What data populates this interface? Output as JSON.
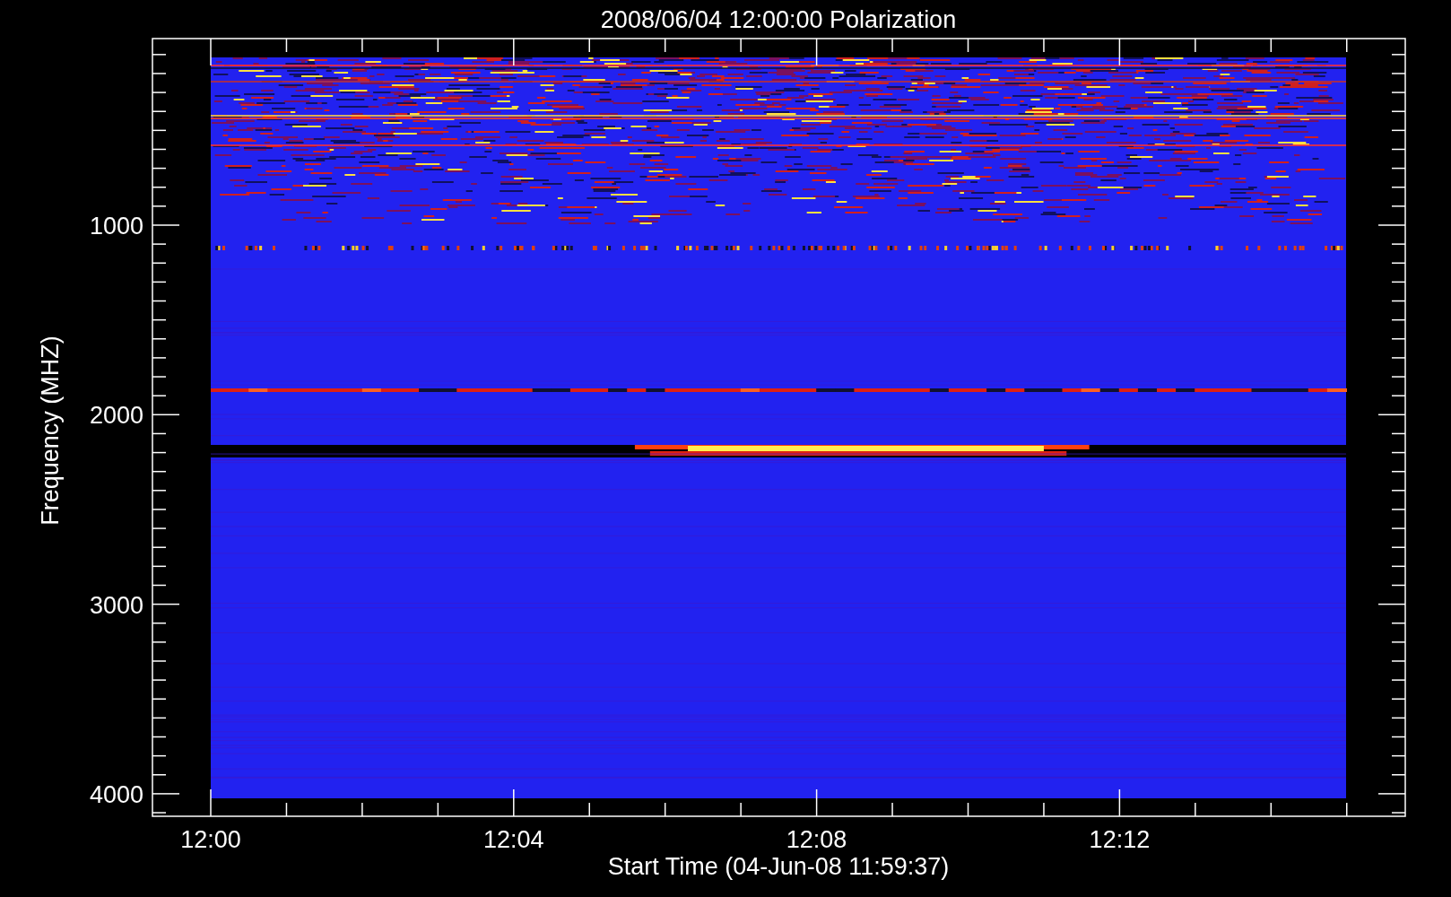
{
  "plot": {
    "title": "2008/06/04 12:00:00 Polarization",
    "xlabel": "Start Time (04-Jun-08 11:59:37)",
    "ylabel": "Frequency (MHZ)",
    "xticks": [
      "12:00",
      "12:04",
      "12:08",
      "12:12"
    ],
    "yticks": [
      "1000",
      "2000",
      "3000",
      "4000"
    ]
  }
}
